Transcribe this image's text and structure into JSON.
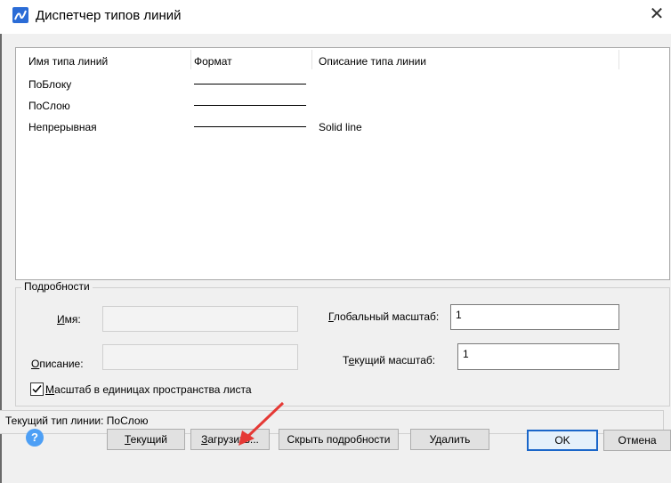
{
  "window": {
    "title": "Диспетчер типов линий",
    "close_glyph": "✕"
  },
  "list": {
    "columns": [
      "Имя типа линий",
      "Формат",
      "Описание типа линии"
    ],
    "rows": [
      {
        "name": "ПоБлоку",
        "description": ""
      },
      {
        "name": "ПоСлою",
        "description": ""
      },
      {
        "name": "Непрерывная",
        "description": "Solid line"
      }
    ]
  },
  "details": {
    "group_title": "Подробности",
    "name_label_u": "И",
    "name_label_rest": "мя:",
    "name_value": "",
    "desc_label_u": "О",
    "desc_label_rest": "писание:",
    "desc_value": "",
    "global_scale_label_u": "Г",
    "global_scale_label_rest": "лобальный масштаб:",
    "global_scale_value": "1",
    "current_scale_label_pre": "Т",
    "current_scale_label_u": "е",
    "current_scale_label_rest": "кущий масштаб:",
    "current_scale_value": "1",
    "paper_space_checkbox_u": "М",
    "paper_space_checkbox_rest": "асштаб в единицах пространства листа",
    "paper_space_checked": true
  },
  "status": {
    "text": "Текущий тип линии: ПоСлою"
  },
  "buttons": {
    "help": "?",
    "current_u": "Т",
    "current_rest": "екущий",
    "load_u": "З",
    "load_rest": "агрузить...",
    "hide_details": "Скрыть подробности",
    "delete": "Удалить",
    "ok": "OK",
    "cancel": "Отмена"
  },
  "colors": {
    "annotation_arrow": "#e53935",
    "primary_border": "#1a66c9",
    "app_icon": "#2b6cd6"
  },
  "icons": {
    "app": "linetype-app-icon",
    "help": "help-icon",
    "close": "close-icon",
    "check": "check-icon"
  }
}
